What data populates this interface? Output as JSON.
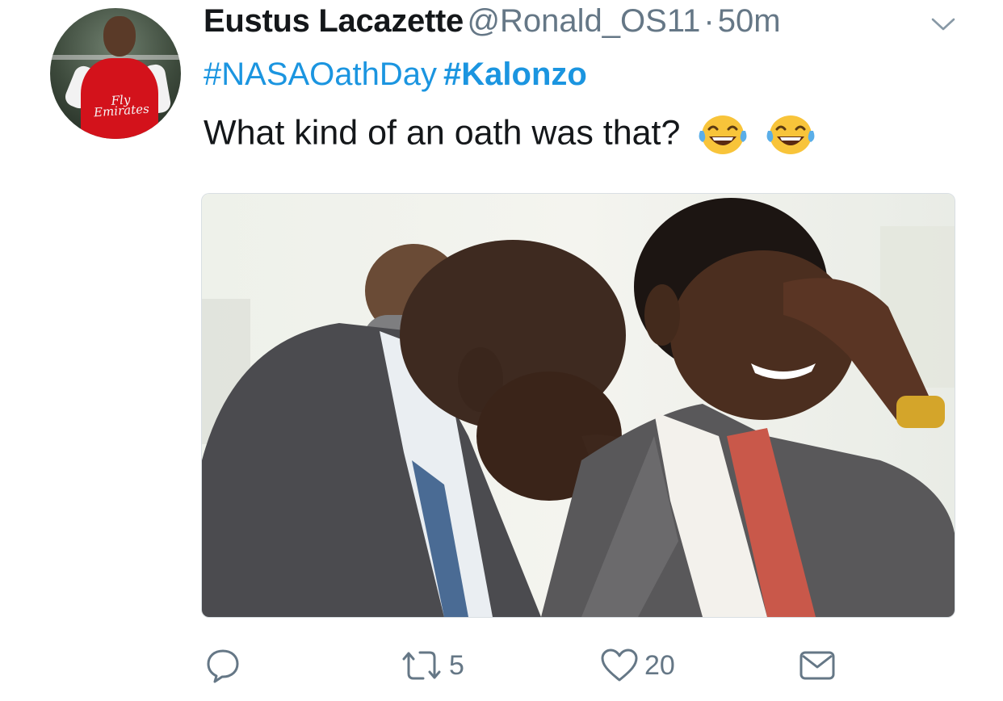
{
  "tweet": {
    "author_name": "Eustus Lacazette",
    "author_handle": "@Ronald_OS11",
    "separator": "·",
    "time": "50m",
    "hashtags": [
      "#NASAOathDay",
      "#Kalonzo"
    ],
    "text": "What kind of an oath was that?",
    "emoji": [
      "face-with-tears-of-joy",
      "face-with-tears-of-joy"
    ],
    "avatar_shirt_text": "Fly Emirates"
  },
  "actions": {
    "reply_count": "",
    "retweet_count": "5",
    "like_count": "20",
    "dm_label": ""
  },
  "colors": {
    "link": "#1b95e0",
    "secondary_text": "#657786",
    "primary_text": "#14171a"
  }
}
